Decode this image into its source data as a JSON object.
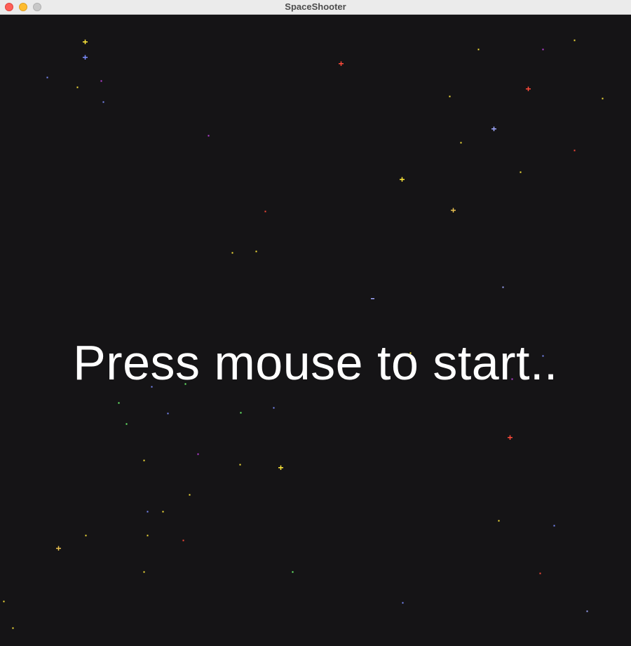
{
  "window": {
    "title": "SpaceShooter"
  },
  "game": {
    "prompt": "Press mouse to start..",
    "background_color": "#151416",
    "star_colors": [
      "#ffe83a",
      "#7c8cff",
      "#ff4a3a",
      "#c040e0",
      "#70ff70",
      "#e8c050",
      "#a0a8ff"
    ]
  }
}
